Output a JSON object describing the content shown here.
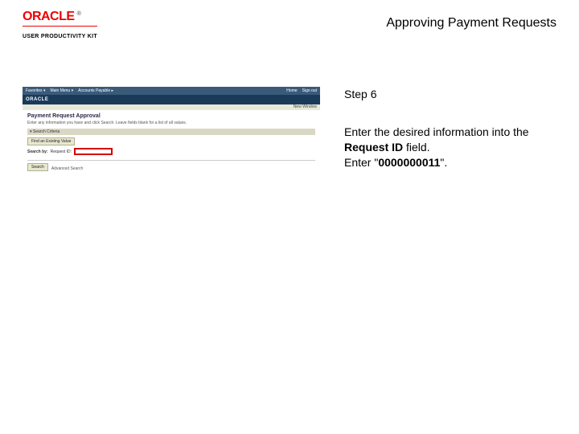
{
  "header": {
    "logo_text": "ORACLE",
    "logo_tm": "®",
    "upk_text": "USER PRODUCTIVITY KIT",
    "page_title": "Approving Payment Requests"
  },
  "instruction": {
    "step_label": "Step 6",
    "line1_a": "Enter the desired information into the ",
    "line1_b": "Request ID",
    "line1_c": " field.",
    "line2_a": "Enter \"",
    "line2_b": "0000000011",
    "line2_c": "\"."
  },
  "mini": {
    "toolbar": {
      "item1": "Favorites ▾",
      "item2": "Main Menu ▾",
      "item3": "Accounts Payable ▸",
      "home": "Home",
      "signout": "Sign out"
    },
    "brand": "ORACLE",
    "subbar": "New Window",
    "h1": "Payment Request Approval",
    "desc": "Enter any information you have and click Search. Leave fields blank for a list of all values.",
    "section": "▾  Search Criteria",
    "find_btn": "Find an Existing Value",
    "search_label": "Search by:",
    "field_label": "Request ID:",
    "footer_btn": "Search",
    "footer_link": "Advanced Search"
  }
}
